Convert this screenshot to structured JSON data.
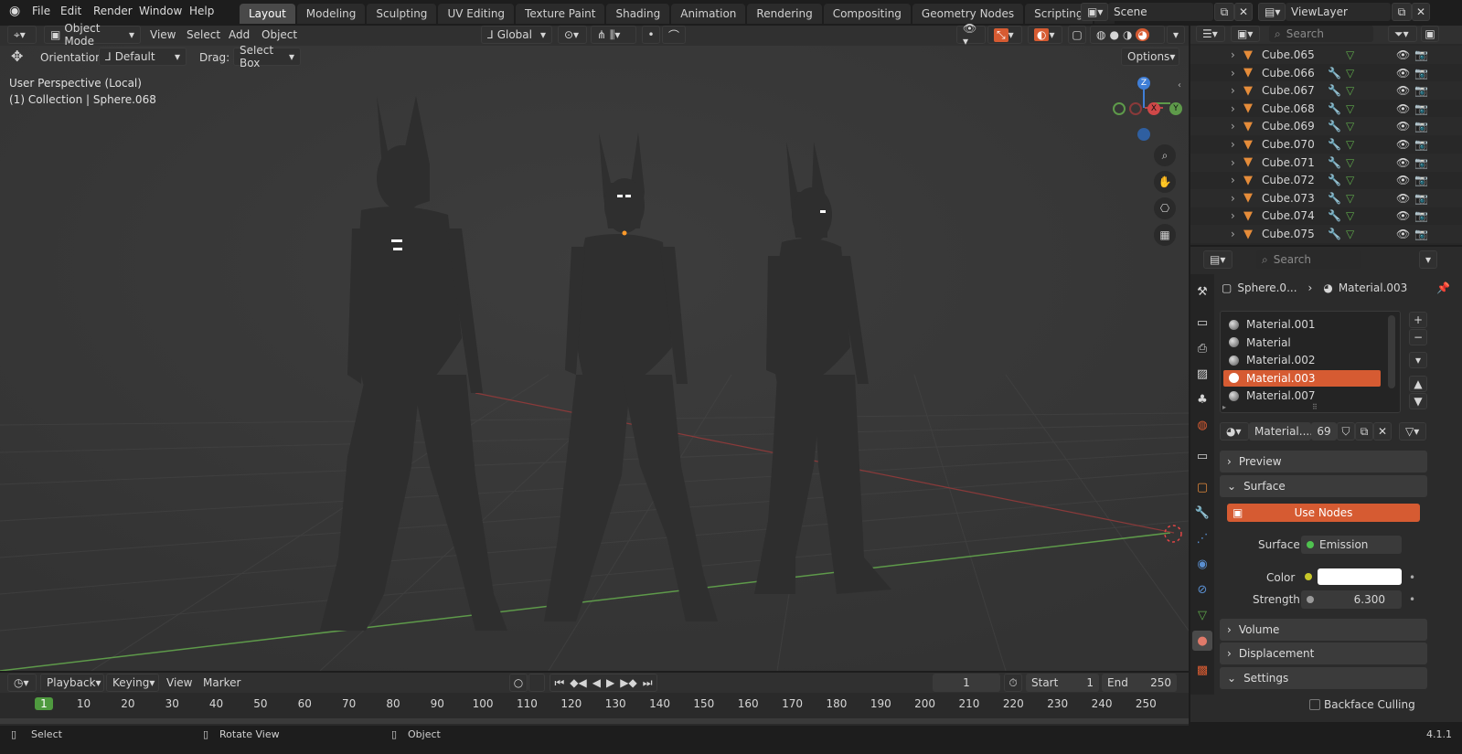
{
  "menu": [
    "File",
    "Edit",
    "Render",
    "Window",
    "Help"
  ],
  "workspaces": [
    {
      "label": "Layout",
      "active": true
    },
    {
      "label": "Modeling"
    },
    {
      "label": "Sculpting"
    },
    {
      "label": "UV Editing"
    },
    {
      "label": "Texture Paint"
    },
    {
      "label": "Shading"
    },
    {
      "label": "Animation"
    },
    {
      "label": "Rendering"
    },
    {
      "label": "Compositing"
    },
    {
      "label": "Geometry Nodes"
    },
    {
      "label": "Scripting"
    }
  ],
  "scene": "Scene",
  "view_layer": "ViewLayer",
  "viewport_header": {
    "mode": "Object Mode",
    "menus": [
      "View",
      "Select",
      "Add",
      "Object"
    ],
    "transform": "Global",
    "orientation_label": "Orientation:",
    "orientation_value": "Default",
    "drag_label": "Drag:",
    "drag_value": "Select Box",
    "options": "Options"
  },
  "viewport_info": {
    "perspective": "User Perspective (Local)",
    "collection": "(1) Collection | Sphere.068"
  },
  "gizmo": {
    "z": "Z",
    "y": "Y",
    "x": "X"
  },
  "outliner": {
    "search_placeholder": "Search",
    "items": [
      "Cube.065",
      "Cube.066",
      "Cube.067",
      "Cube.068",
      "Cube.069",
      "Cube.070",
      "Cube.071",
      "Cube.072",
      "Cube.073",
      "Cube.074",
      "Cube.075"
    ]
  },
  "properties": {
    "search_placeholder": "Search",
    "breadcrumb_object": "Sphere.0...",
    "breadcrumb_material": "Material.003",
    "slots": [
      "Material.001",
      "Material",
      "Material.002",
      "Material.003",
      "Material.007"
    ],
    "active_slot": 3,
    "material_name": "Material....",
    "user_count": "69",
    "panels": {
      "preview": "Preview",
      "surface": "Surface",
      "volume": "Volume",
      "displacement": "Displacement",
      "settings": "Settings"
    },
    "use_nodes": "Use Nodes",
    "surface_label": "Surface",
    "surface_value": "Emission",
    "color_label": "Color",
    "color_value": "#ffffff",
    "strength_label": "Strength",
    "strength_value": "6.300",
    "backface_culling": "Backface Culling"
  },
  "timeline": {
    "playback": "Playback",
    "keying": "Keying",
    "view": "View",
    "marker": "Marker",
    "current_frame": "1",
    "start_label": "Start",
    "start": "1",
    "end_label": "End",
    "end": "250",
    "ruler": [
      "1",
      "10",
      "20",
      "30",
      "40",
      "50",
      "60",
      "70",
      "80",
      "90",
      "100",
      "110",
      "120",
      "130",
      "140",
      "150",
      "160",
      "170",
      "180",
      "190",
      "200",
      "210",
      "220",
      "230",
      "240",
      "250"
    ]
  },
  "status": {
    "select": "Select",
    "rotate": "Rotate View",
    "object": "Object",
    "version": "4.1.1"
  },
  "colors": {
    "accent": "#d65b32",
    "active_tab": "#494949",
    "x_axis": "#b8454a",
    "y_axis": "#5e9a4a",
    "z_axis": "#3f7ed6",
    "frame_marker": "#4f9a3f"
  }
}
